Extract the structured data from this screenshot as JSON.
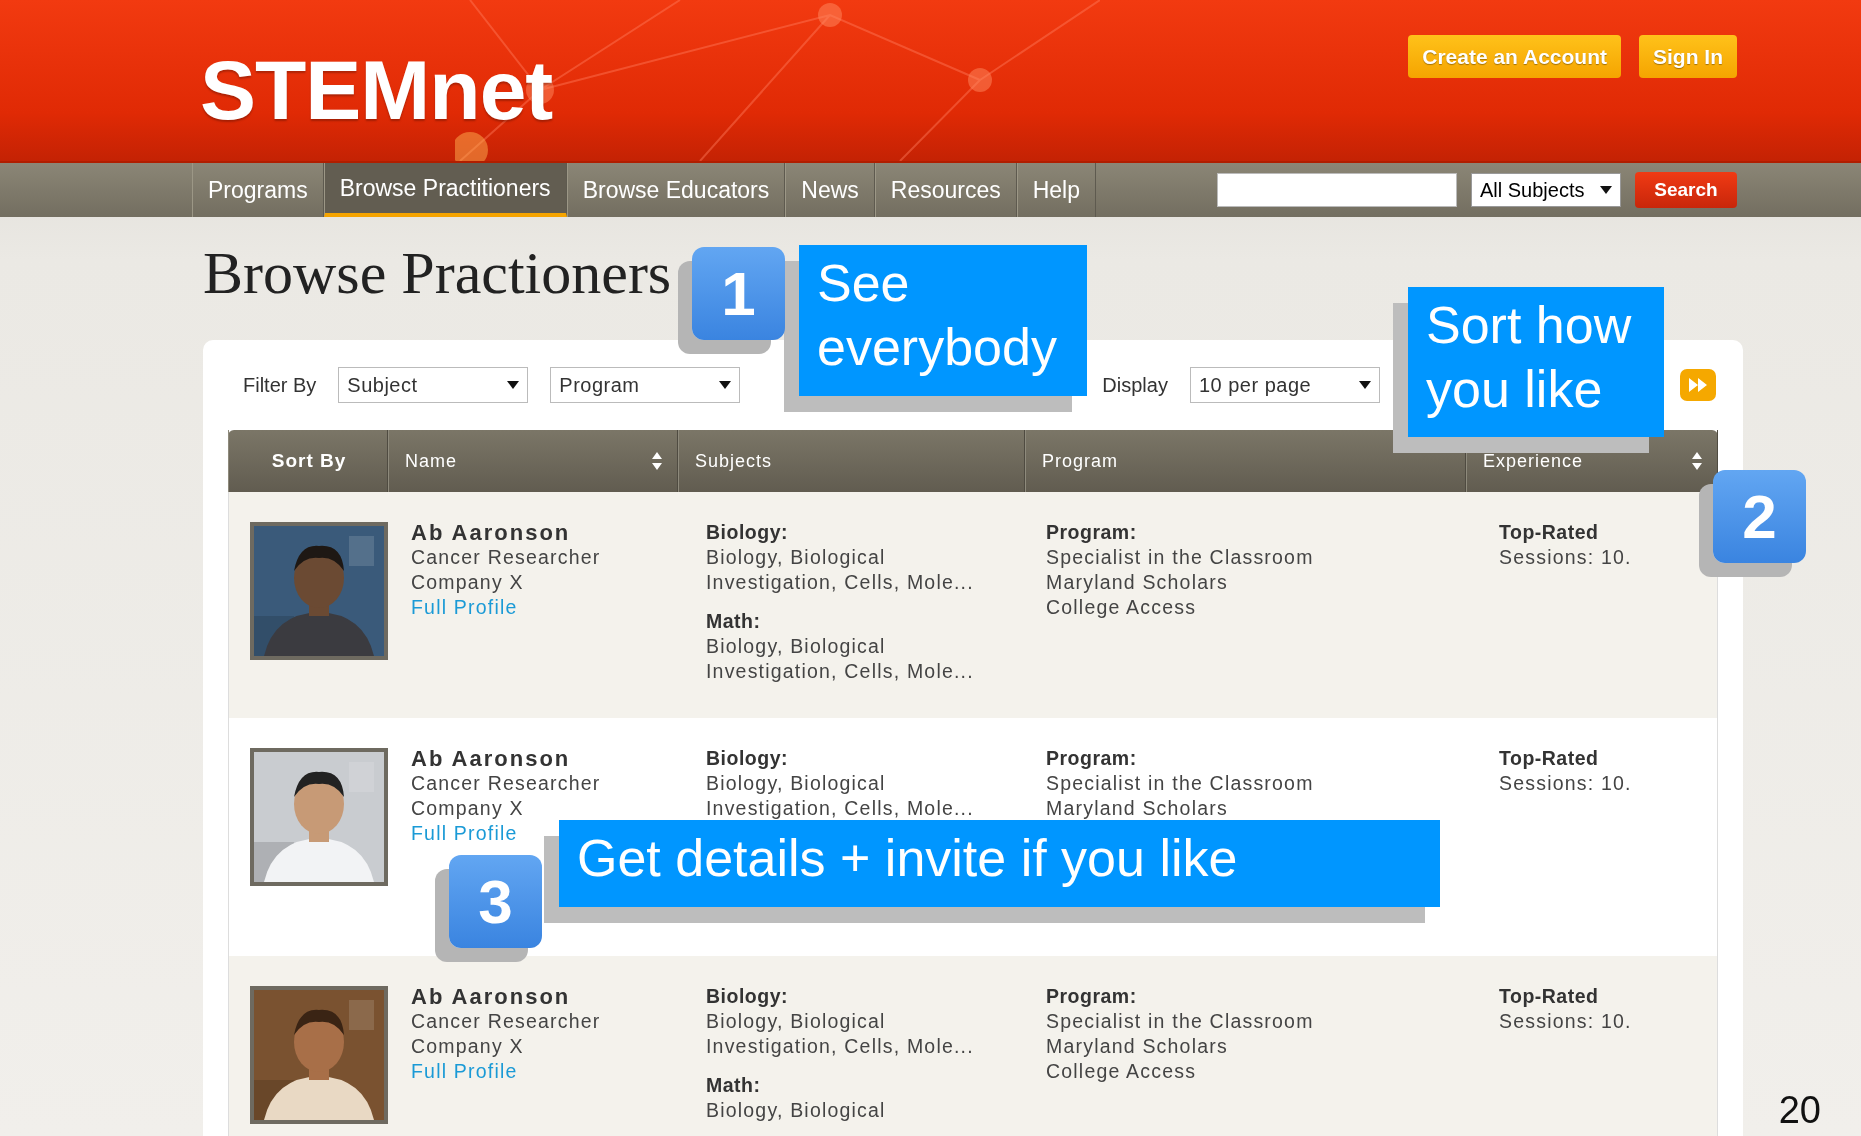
{
  "header": {
    "logo": "STEMnet",
    "buttons": [
      "Create an Account",
      "Sign In"
    ]
  },
  "nav": {
    "items": [
      {
        "label": "Programs",
        "selected": false
      },
      {
        "label": "Browse Practitioners",
        "selected": true
      },
      {
        "label": "Browse Educators",
        "selected": false
      },
      {
        "label": "News",
        "selected": false
      },
      {
        "label": "Resources",
        "selected": false
      },
      {
        "label": "Help",
        "selected": false
      }
    ],
    "subject_select": "All Subjects",
    "search_button": "Search"
  },
  "page": {
    "title": "Browse Practioners"
  },
  "filters": {
    "label": "Filter By",
    "selects": [
      "Subject",
      "Program"
    ],
    "display_label": "Display",
    "display_select": "10 per page"
  },
  "table": {
    "columns": [
      {
        "label": "Sort By",
        "sortable": false
      },
      {
        "label": "Name",
        "sortable": true
      },
      {
        "label": "Subjects",
        "sortable": false
      },
      {
        "label": "Program",
        "sortable": false
      },
      {
        "label": "Experience",
        "sortable": true
      }
    ],
    "rows": [
      {
        "name": "Ab Aaronson",
        "title": "Cancer Researcher",
        "company": "Company X",
        "link": "Full Profile",
        "subjects": [
          {
            "heading": "Biology:",
            "text": "Biology, Biological\nInvestigation, Cells, Mole..."
          },
          {
            "heading": "Math:",
            "text": "Biology, Biological\nInvestigation, Cells, Mole..."
          }
        ],
        "program": {
          "heading": "Program:",
          "items": [
            "Specialist in the Classroom",
            "Maryland Scholars",
            "College Access"
          ]
        },
        "experience": {
          "heading": "Top-Rated",
          "text": "Sessions: 10."
        }
      },
      {
        "name": "Ab Aaronson",
        "title": "Cancer Researcher",
        "company": "Company X",
        "link": "Full Profile",
        "subjects": [
          {
            "heading": "Biology:",
            "text": "Biology, Biological\nInvestigation, Cells, Mole..."
          }
        ],
        "program": {
          "heading": "Program:",
          "items": [
            "Specialist in the Classroom",
            "Maryland Scholars"
          ]
        },
        "experience": {
          "heading": "Top-Rated",
          "text": "Sessions: 10."
        }
      },
      {
        "name": "Ab Aaronson",
        "title": "Cancer Researcher",
        "company": "Company X",
        "link": "Full Profile",
        "subjects": [
          {
            "heading": "Biology:",
            "text": "Biology, Biological\nInvestigation, Cells, Mole..."
          },
          {
            "heading": "Math:",
            "text": "Biology, Biological"
          }
        ],
        "program": {
          "heading": "Program:",
          "items": [
            "Specialist in the Classroom",
            "Maryland Scholars",
            "College Access"
          ]
        },
        "experience": {
          "heading": "Top-Rated",
          "text": "Sessions: 10."
        }
      }
    ]
  },
  "callouts": [
    {
      "number": "1",
      "text": "See everybody"
    },
    {
      "number": "2",
      "text": "Sort how you like"
    },
    {
      "number": "3",
      "text": "Get details + invite if you like"
    }
  ],
  "slide_number": "20"
}
